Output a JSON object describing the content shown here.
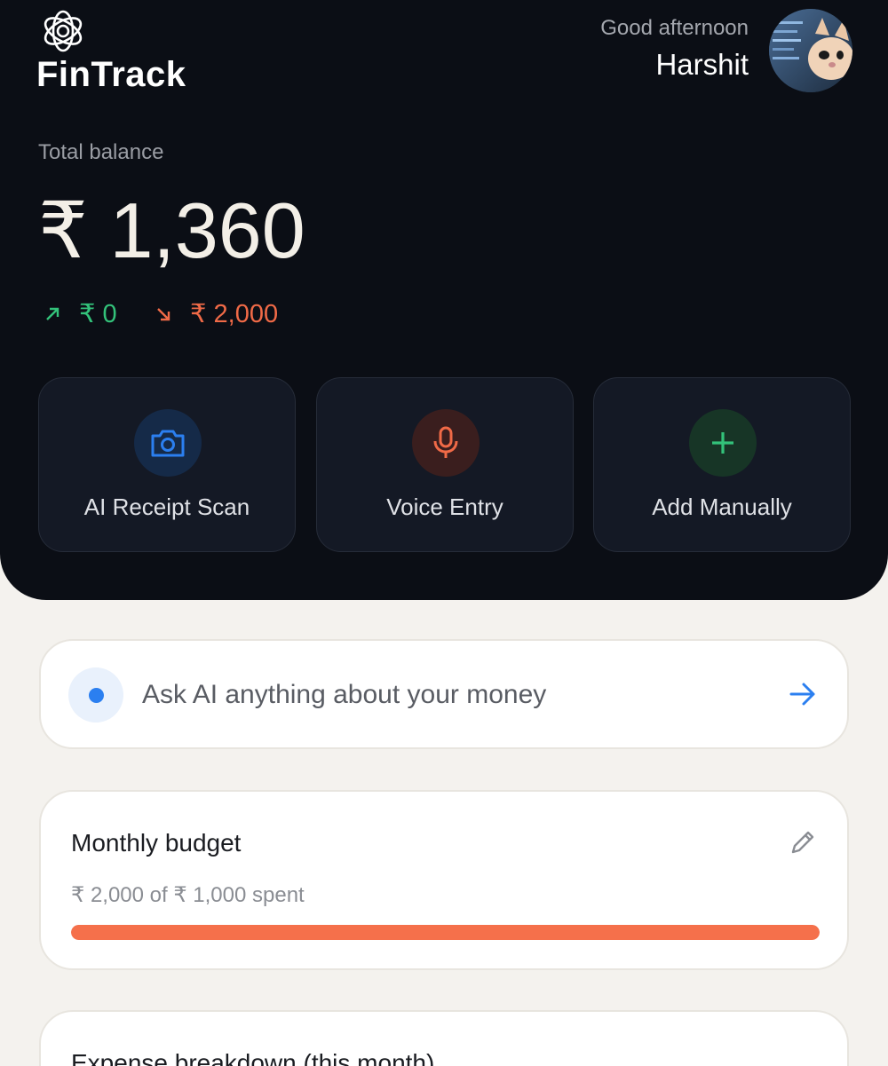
{
  "app": {
    "name": "FinTrack"
  },
  "header": {
    "greeting": "Good afternoon",
    "user_name": "Harshit"
  },
  "balance": {
    "label": "Total balance",
    "amount": "₹ 1,360",
    "income": "₹ 0",
    "expense": "₹ 2,000"
  },
  "actions": [
    {
      "label": "AI Receipt Scan",
      "icon": "camera-icon",
      "color": "#2b7ff0"
    },
    {
      "label": "Voice Entry",
      "icon": "microphone-icon",
      "color": "#f06a47"
    },
    {
      "label": "Add Manually",
      "icon": "plus-icon",
      "color": "#33c27a"
    }
  ],
  "ask_ai": {
    "text": "Ask AI anything about your money"
  },
  "budget": {
    "title": "Monthly budget",
    "summary": "₹ 2,000 of ₹ 1,000 spent",
    "progress_fraction": 1.0
  },
  "expense_breakdown": {
    "title": "Expense breakdown (this month)"
  },
  "colors": {
    "hero_bg": "#0b0e15",
    "income": "#33c27a",
    "expense": "#f06a47",
    "accent": "#2b7ff0",
    "budget_bar": "#f5704b"
  }
}
